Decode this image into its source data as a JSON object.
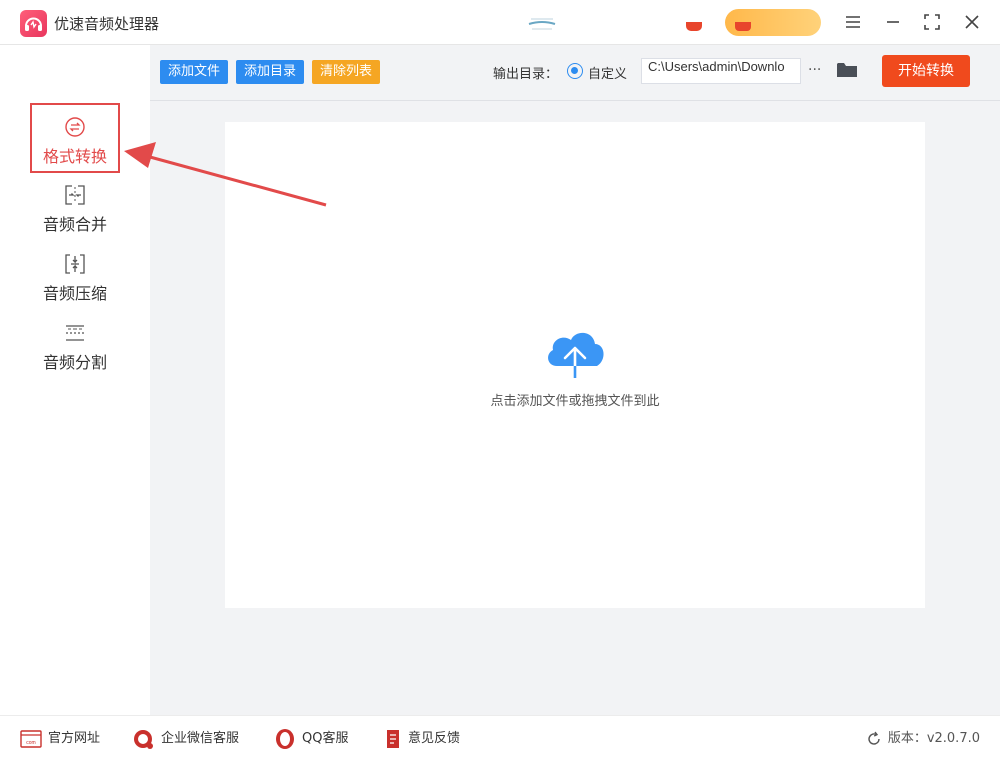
{
  "app": {
    "title": "优速音频处理器"
  },
  "sidebar": {
    "items": [
      {
        "label": "格式转换",
        "icon": "format-convert-icon",
        "active": true
      },
      {
        "label": "音频合并",
        "icon": "audio-merge-icon",
        "active": false
      },
      {
        "label": "音频压缩",
        "icon": "audio-compress-icon",
        "active": false
      },
      {
        "label": "音频分割",
        "icon": "audio-split-icon",
        "active": false
      }
    ]
  },
  "toolbar": {
    "add_file": "添加文件",
    "add_dir": "添加目录",
    "clear_list": "清除列表",
    "output_label": "输出目录：",
    "radio_label": "自定义",
    "output_path": "C:\\Users\\admin\\Downlo",
    "more": "···",
    "start": "开始转换"
  },
  "dropzone": {
    "hint": "点击添加文件或拖拽文件到此"
  },
  "footer": {
    "links": [
      {
        "label": "官方网址",
        "icon": "website-icon"
      },
      {
        "label": "企业微信客服",
        "icon": "wecom-icon"
      },
      {
        "label": "QQ客服",
        "icon": "qq-icon"
      },
      {
        "label": "意见反馈",
        "icon": "feedback-icon"
      }
    ],
    "version": "版本：v2.0.7.0"
  },
  "colors": {
    "accent_blue": "#2d8cf0",
    "accent_orange": "#f5a623",
    "start_red": "#f04a1d",
    "annotation_red": "#e24a4a"
  }
}
